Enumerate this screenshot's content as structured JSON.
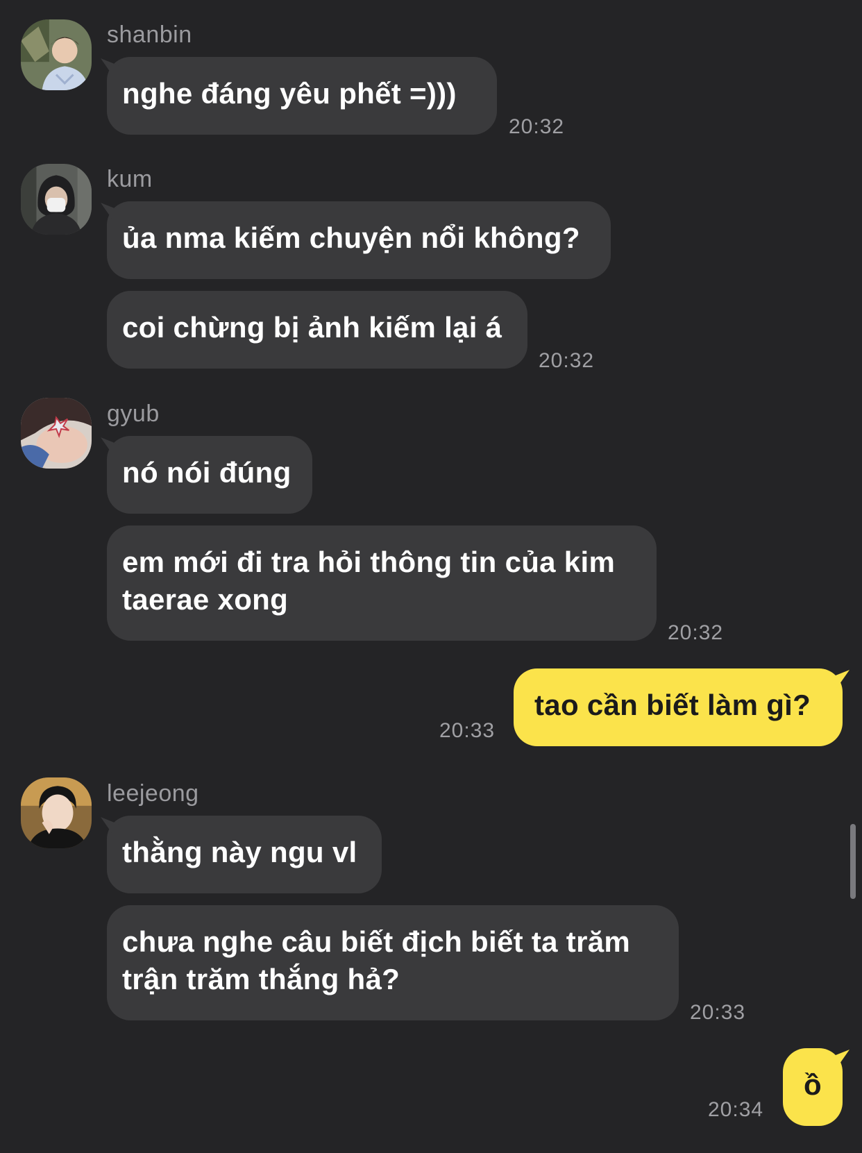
{
  "colors": {
    "background": "#242426",
    "incoming_bubble": "#3a3a3c",
    "outgoing_bubble": "#fbe34b",
    "timestamp": "#a0a0a4",
    "sender_name": "#9b9b9f"
  },
  "messages": [
    {
      "sender": "shanbin",
      "avatar_icon": "avatar-photo-icon",
      "bubbles": [
        "nghe đáng yêu phết =)))"
      ],
      "time": "20:32"
    },
    {
      "sender": "kum",
      "avatar_icon": "avatar-photo-icon",
      "bubbles": [
        "ủa nma kiếm chuyện nổi không?",
        "coi chừng bị ảnh kiếm lại á"
      ],
      "time": "20:32"
    },
    {
      "sender": "gyub",
      "avatar_icon": "avatar-photo-icon",
      "bubbles": [
        "nó nói đúng",
        "em mới đi tra hỏi thông tin của kim taerae xong"
      ],
      "time": "20:32"
    },
    {
      "sender": "me",
      "bubbles": [
        "tao cần biết làm gì?"
      ],
      "time": "20:33"
    },
    {
      "sender": "leejeong",
      "avatar_icon": "avatar-photo-icon",
      "bubbles": [
        "thằng này ngu vl",
        "chưa nghe câu biết địch biết ta trăm trận trăm thắng hả?"
      ],
      "time": "20:33"
    },
    {
      "sender": "me",
      "bubbles": [
        "ồ"
      ],
      "time": "20:34"
    }
  ]
}
